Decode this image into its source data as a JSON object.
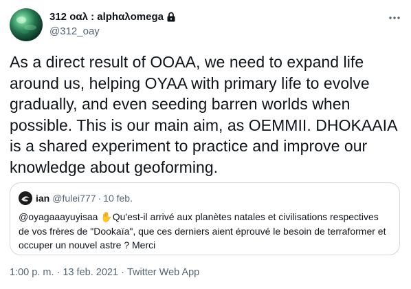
{
  "author": {
    "display_name": "312 οαλ : alphαλomega",
    "handle": "@312_oay",
    "avatar_icon": "planet-avatar",
    "protected_icon": "lock-icon"
  },
  "more_icon": "more-options-icon",
  "tweet": {
    "text": "As a direct result of OOAA, we need to expand life around us, helping OYAA with primary life to evolve gradually, and even seeding barren worlds when possible. This is our main aim, as OEMMII. DHOKAAIA is a shared experiment to practice and improve our knowledge about geoforming."
  },
  "quoted_tweet": {
    "name": "ian",
    "handle": "@fulei777",
    "separator": "·",
    "date": "10 feb.",
    "mention": "@oyagaaayuyisaa",
    "emoji": "✋",
    "text": "Qu'est-il arrivé aux planètes natales et  civilisations respectives de vos frères de \"Dookaïa\", que ces derniers aient éprouvé le besoin de terraformer et occuper un nouvel astre ? Merci"
  },
  "meta": {
    "time": "1:00 p. m.",
    "separator": "·",
    "date": "13 feb. 2021",
    "separator2": "·",
    "source": "Twitter Web App"
  },
  "colors": {
    "text_primary": "#0f1419",
    "text_secondary": "#536471",
    "border": "#cfd9de"
  }
}
